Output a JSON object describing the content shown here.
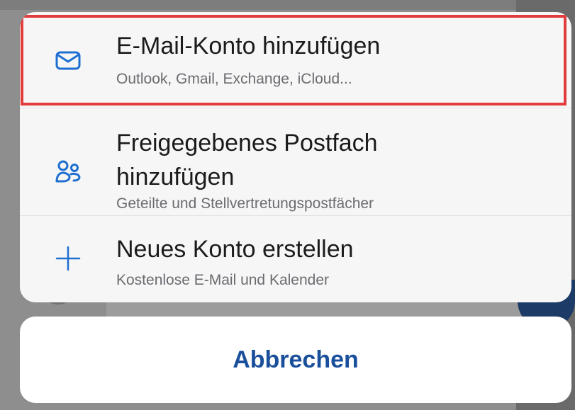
{
  "action_sheet": {
    "items": [
      {
        "icon": "envelope-icon",
        "title": "E-Mail-Konto hinzufügen",
        "subtitle": "Outlook, Gmail, Exchange, iCloud...",
        "highlighted": true
      },
      {
        "icon": "people-icon",
        "title": "Freigegebenes Postfach hinzufügen",
        "subtitle": "Geteilte und Stellvertretungspostfächer",
        "highlighted": false
      },
      {
        "icon": "plus-icon",
        "title": "Neues Konto erstellen",
        "subtitle": "Kostenlose E-Mail und Kalender",
        "highlighted": false
      }
    ],
    "cancel_label": "Abbrechen"
  },
  "colors": {
    "accent": "#1e6fd0",
    "cancel_text": "#1a4f9c",
    "highlight_border": "#e23b3b"
  }
}
